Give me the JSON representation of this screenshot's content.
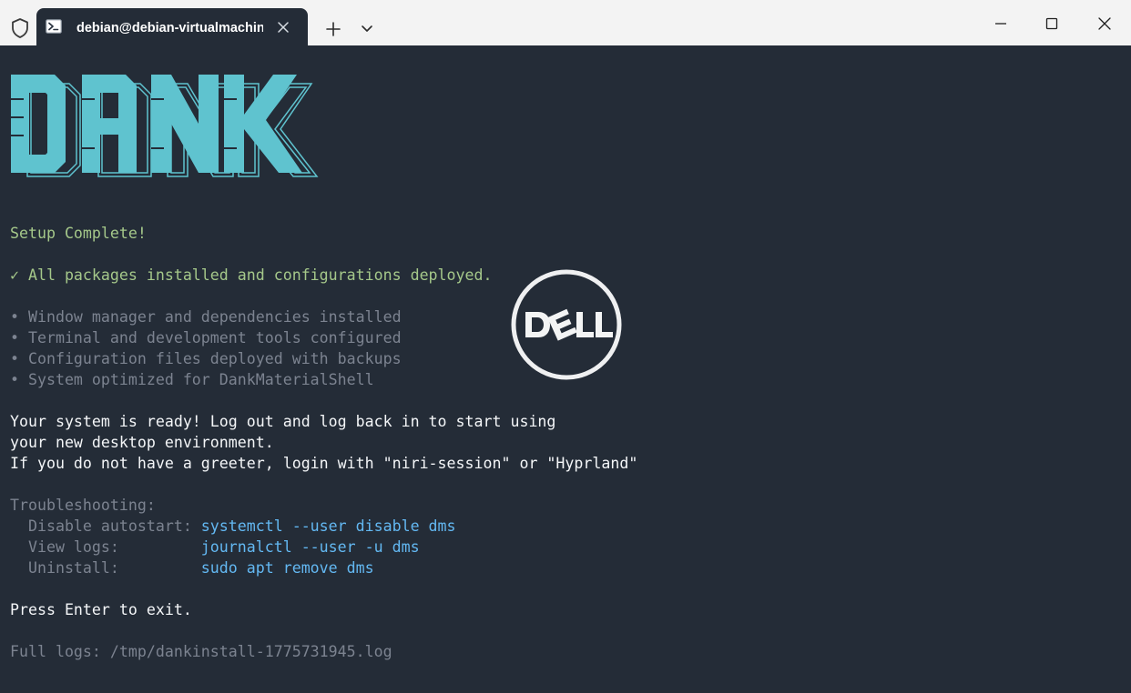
{
  "window": {
    "tab_title": "debian@debian-virtualmachin",
    "icons": {
      "security": "shield-icon",
      "tab": "powershell-icon",
      "tab_close": "close-icon",
      "new_tab": "plus-icon",
      "dropdown": "chevron-down-icon",
      "minimize": "minimize-icon",
      "maximize": "maximize-icon",
      "close": "close-icon"
    }
  },
  "terminal": {
    "banner_text": "DANK",
    "setup_complete": "Setup Complete!",
    "all_installed": "✓ All packages installed and configurations deployed.",
    "bullets": [
      "• Window manager and dependencies installed",
      "• Terminal and development tools configured",
      "• Configuration files deployed with backups",
      "• System optimized for DankMaterialShell"
    ],
    "ready_lines": [
      "Your system is ready! Log out and log back in to start using",
      "your new desktop environment.",
      "If you do not have a greeter, login with \"niri-session\" or \"Hyprland\""
    ],
    "troubleshooting": {
      "heading": "Troubleshooting:",
      "items": [
        {
          "label": "  Disable autostart: ",
          "command": "systemctl --user disable dms"
        },
        {
          "label": "  View logs:         ",
          "command": "journalctl --user -u dms"
        },
        {
          "label": "  Uninstall:         ",
          "command": "sudo apt remove dms"
        }
      ]
    },
    "press_enter": "Press Enter to exit.",
    "full_logs": "Full logs: /tmp/dankinstall-1775731945.log"
  },
  "overlay": {
    "logo_text": "DELL"
  },
  "colors": {
    "terminal_bg": "#242c37",
    "banner": "#5fc3cf",
    "green": "#a5c88a",
    "dim": "#7c8390",
    "command_blue": "#63b8f2",
    "titlebar": "#f3f3f3"
  }
}
